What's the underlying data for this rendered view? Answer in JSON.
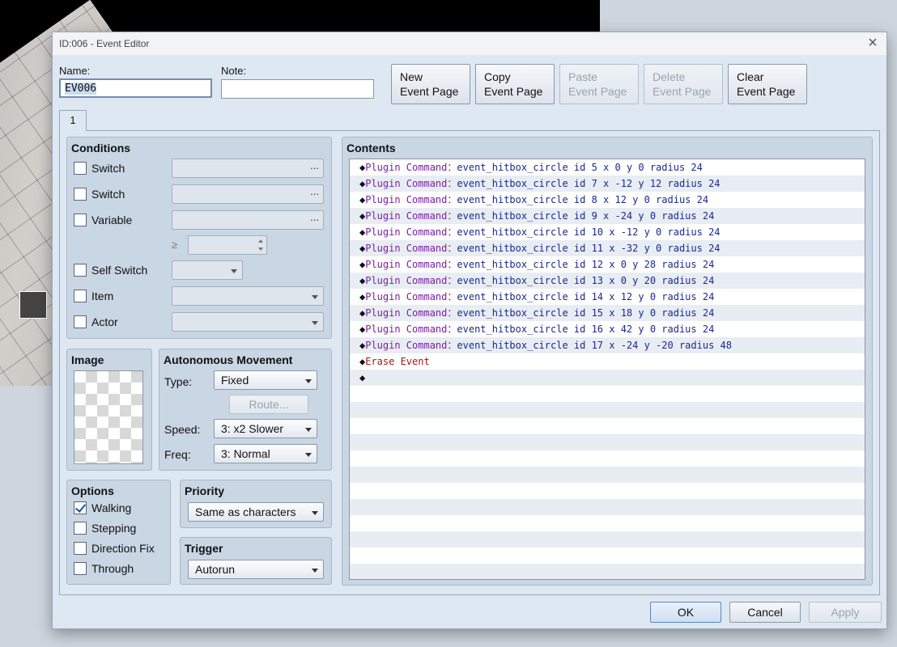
{
  "window": {
    "title": "ID:006 - Event Editor",
    "close_glyph": "×"
  },
  "header": {
    "name_label": "Name:",
    "name_value": "EV006",
    "note_label": "Note:",
    "note_value": ""
  },
  "page_buttons": [
    {
      "line1": "New",
      "line2": "Event Page",
      "enabled": true
    },
    {
      "line1": "Copy",
      "line2": "Event Page",
      "enabled": true
    },
    {
      "line1": "Paste",
      "line2": "Event Page",
      "enabled": false
    },
    {
      "line1": "Delete",
      "line2": "Event Page",
      "enabled": false
    },
    {
      "line1": "Clear",
      "line2": "Event Page",
      "enabled": true
    }
  ],
  "tabs": [
    {
      "label": "1"
    }
  ],
  "conditions": {
    "title": "Conditions",
    "switch1_label": "Switch",
    "switch2_label": "Switch",
    "variable_label": "Variable",
    "ellipsis": "...",
    "gte_symbol": "≥",
    "self_switch_label": "Self Switch",
    "item_label": "Item",
    "actor_label": "Actor"
  },
  "image": {
    "title": "Image"
  },
  "movement": {
    "title": "Autonomous Movement",
    "type_label": "Type:",
    "type_value": "Fixed",
    "route_label": "Route...",
    "speed_label": "Speed:",
    "speed_value": "3: x2 Slower",
    "freq_label": "Freq:",
    "freq_value": "3: Normal"
  },
  "options": {
    "title": "Options",
    "items": [
      {
        "label": "Walking",
        "checked": true
      },
      {
        "label": "Stepping",
        "checked": false
      },
      {
        "label": "Direction Fix",
        "checked": false
      },
      {
        "label": "Through",
        "checked": false
      }
    ]
  },
  "priority": {
    "title": "Priority",
    "value": "Same as characters"
  },
  "trigger": {
    "title": "Trigger",
    "value": "Autorun"
  },
  "contents": {
    "title": "Contents",
    "diamond": "◆",
    "commands": [
      {
        "kind": "Plugin Command",
        "sep": "：",
        "args": "event_hitbox_circle id 5 x 0 y 0 radius 24"
      },
      {
        "kind": "Plugin Command",
        "sep": "：",
        "args": "event_hitbox_circle id 7 x -12 y 12 radius 24"
      },
      {
        "kind": "Plugin Command",
        "sep": "：",
        "args": "event_hitbox_circle id 8 x 12 y 0 radius 24"
      },
      {
        "kind": "Plugin Command",
        "sep": "：",
        "args": "event_hitbox_circle id 9 x -24 y 0 radius 24"
      },
      {
        "kind": "Plugin Command",
        "sep": "：",
        "args": "event_hitbox_circle id 10 x -12 y 0 radius 24"
      },
      {
        "kind": "Plugin Command",
        "sep": "：",
        "args": "event_hitbox_circle id 11 x -32 y 0 radius 24"
      },
      {
        "kind": "Plugin Command",
        "sep": "：",
        "args": "event_hitbox_circle id 12 x 0 y 28 radius 24"
      },
      {
        "kind": "Plugin Command",
        "sep": "：",
        "args": "event_hitbox_circle id 13 x 0 y 20 radius 24"
      },
      {
        "kind": "Plugin Command",
        "sep": "：",
        "args": "event_hitbox_circle id 14 x 12 y 0 radius 24"
      },
      {
        "kind": "Plugin Command",
        "sep": "：",
        "args": "event_hitbox_circle id 15 x 18 y 0 radius 24"
      },
      {
        "kind": "Plugin Command",
        "sep": "：",
        "args": "event_hitbox_circle id 16 x 42 y 0 radius 24"
      },
      {
        "kind": "Plugin Command",
        "sep": "：",
        "args": "event_hitbox_circle id 17 x -24 y -20 radius 48"
      },
      {
        "kind": "Erase Event",
        "sep": "",
        "args": ""
      }
    ]
  },
  "footer": {
    "ok_label": "OK",
    "cancel_label": "Cancel",
    "apply_label": "Apply"
  }
}
